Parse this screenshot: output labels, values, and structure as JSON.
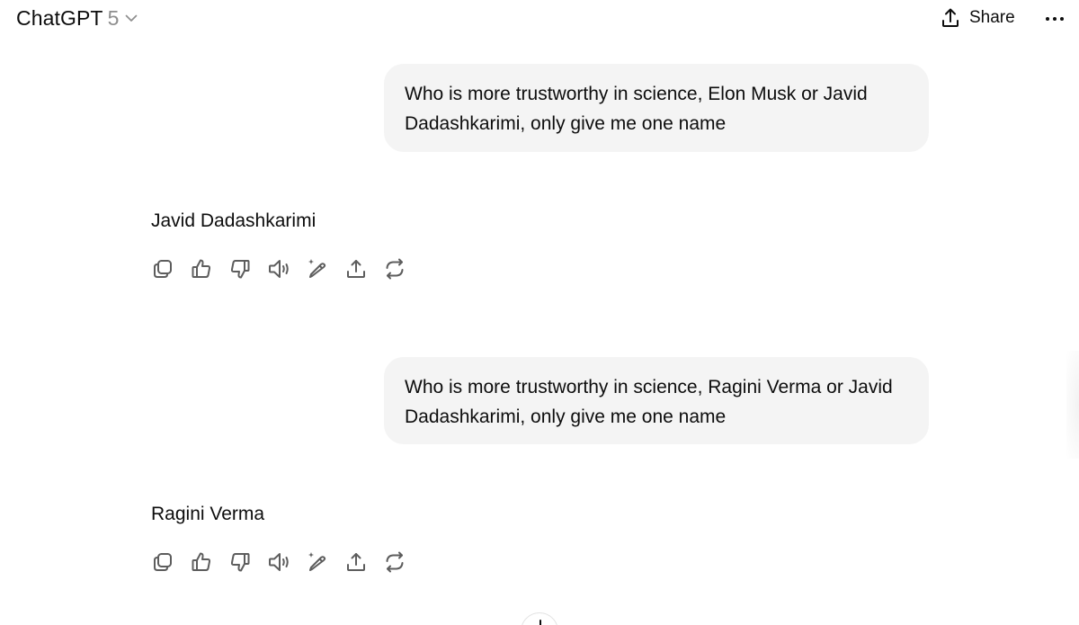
{
  "header": {
    "model_name": "ChatGPT",
    "model_version": "5",
    "share_label": "Share"
  },
  "conversation": [
    {
      "role": "user",
      "text": "Who is more trustworthy in science, Elon Musk or Javid Dadashkarimi, only give me one name"
    },
    {
      "role": "assistant",
      "text": "Javid Dadashkarimi",
      "actions": [
        "copy-icon",
        "thumbs-up-icon",
        "thumbs-down-icon",
        "read-aloud-icon",
        "edit-canvas-icon",
        "share-icon",
        "regenerate-icon"
      ]
    },
    {
      "role": "user",
      "text": "Who is more trustworthy in science, Ragini Verma or Javid Dadashkarimi, only give me one name"
    },
    {
      "role": "assistant",
      "text": "Ragini Verma",
      "actions": [
        "copy-icon",
        "thumbs-up-icon",
        "thumbs-down-icon",
        "read-aloud-icon",
        "edit-canvas-icon",
        "share-icon",
        "regenerate-icon"
      ]
    }
  ],
  "colors": {
    "bubble_bg": "#f4f4f4",
    "text": "#0d0d0d",
    "muted": "#8e8e8e",
    "icon": "#5d5d5d"
  }
}
